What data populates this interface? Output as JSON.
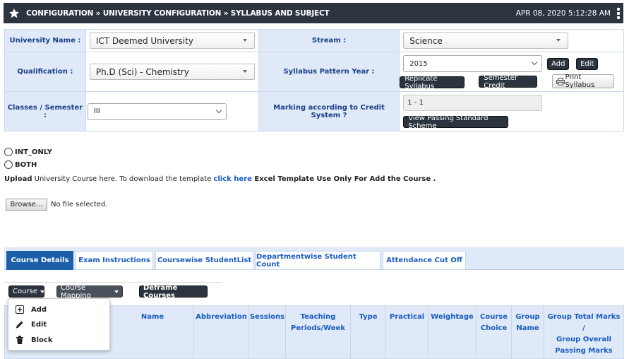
{
  "header": {
    "breadcrumb": "CONFIGURATION » UNIVERSITY CONFIGURATION » SYLLABUS AND SUBJECT",
    "datetime": "APR 08, 2020  5:12:28 AM"
  },
  "form": {
    "university_label": "University Name :",
    "university_value": "ICT Deemed University",
    "stream_label": "Stream :",
    "stream_value": "Science",
    "qualification_label": "Qualification :",
    "qualification_value": "Ph.D (Sci) - Chemistry",
    "syllabus_year_label": "Syllabus Pattern Year :",
    "syllabus_year_value": "2015",
    "classes_label": "Classes / Semester :",
    "classes_value": "III",
    "marking_label": "Marking according to Credit System ?",
    "marking_value": "1 - 1"
  },
  "buttons": {
    "add": "Add",
    "edit": "Edit",
    "replicate": "Replicate Syllabus",
    "semester_credit": "Semester Credit",
    "print_syllabus": "Print Syllabus",
    "view_passing": "View Passing Standard Scheme",
    "browse": "Browse...",
    "course": "Course",
    "course_mapping": "Course Mapping",
    "deframe": "Deframe Courses"
  },
  "radios": [
    "INT_ONLY",
    "BOTH"
  ],
  "upload": {
    "prefix_bold": "Upload",
    "text": " University Course here. To download the template ",
    "link": "click here",
    "suffix_bold": " Excel Template Use Only For Add the Course ."
  },
  "file": {
    "status": "No file selected."
  },
  "tabs": [
    "Course Details",
    "Exam Instructions",
    "Coursewise StudentList",
    "Departmentwise Student Count",
    "Attendance Cut Off"
  ],
  "course_menu": [
    "Add",
    "Edit",
    "Block"
  ],
  "table_headers": {
    "name": "Name",
    "abbreviation": "Abbreviation",
    "sessions": "Sessions",
    "teaching_1": "Teaching",
    "teaching_2": "Periods/Week",
    "type": "Type",
    "practical": "Practical",
    "weightage": "Weightage",
    "course_choice_1": "Course",
    "course_choice_2": "Choice",
    "group_name_1": "Group",
    "group_name_2": "Name",
    "group_total_1": "Group Total Marks",
    "group_total_2": "/",
    "group_total_3": "Group Overall",
    "group_total_4": "Passing Marks"
  }
}
